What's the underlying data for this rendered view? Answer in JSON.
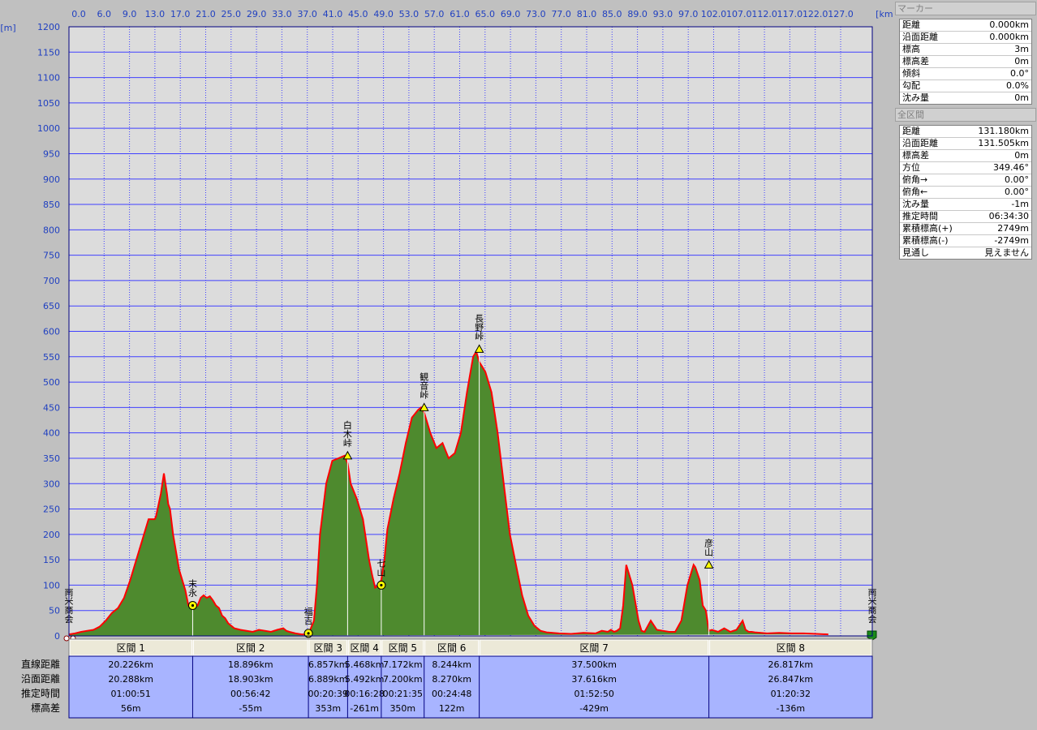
{
  "marker_panel": {
    "title": "マーカー",
    "rows": [
      {
        "label": "距離",
        "value": "0.000km"
      },
      {
        "label": "沿面距離",
        "value": "0.000km"
      },
      {
        "label": "標高",
        "value": "3m"
      },
      {
        "label": "標高差",
        "value": "0m"
      },
      {
        "label": "傾斜",
        "value": "0.0°"
      },
      {
        "label": "勾配",
        "value": "0.0%"
      },
      {
        "label": "沈み量",
        "value": "0m"
      }
    ]
  },
  "all_section_panel": {
    "title": "全区間",
    "rows": [
      {
        "label": "距離",
        "value": "131.180km"
      },
      {
        "label": "沿面距離",
        "value": "131.505km"
      },
      {
        "label": "標高差",
        "value": "0m"
      },
      {
        "label": "方位",
        "value": "349.46°"
      },
      {
        "label": "俯角→",
        "value": "0.00°"
      },
      {
        "label": "俯角←",
        "value": "0.00°"
      },
      {
        "label": "沈み量",
        "value": "-1m"
      },
      {
        "label": "推定時間",
        "value": "06:34:30"
      },
      {
        "label": "累積標高(+)",
        "value": "2749m"
      },
      {
        "label": "累積標高(-)",
        "value": "-2749m"
      },
      {
        "label": "見通し",
        "value": "見えません"
      }
    ]
  },
  "colors": {
    "fill": "#4e8a2e",
    "line": "#ff0000",
    "plot_bg": "#dcdcdc",
    "grid": "#4040ff",
    "table_bg": "#a8b4ff"
  },
  "chart_data": {
    "type": "area",
    "x_unit": "[km]",
    "y_unit": "[m]",
    "xlim": [
      0,
      131.18
    ],
    "ylim": [
      0,
      1200
    ],
    "x_tick_labels": [
      "0.0",
      "6.0",
      "9.0",
      "13.0",
      "17.0",
      "21.0",
      "25.0",
      "29.0",
      "33.0",
      "37.0",
      "41.0",
      "45.0",
      "49.0",
      "53.0",
      "57.0",
      "61.0",
      "65.0",
      "69.0",
      "73.0",
      "77.0",
      "81.0",
      "85.0",
      "89.0",
      "93.0",
      "97.0",
      "102.0",
      "107.0",
      "112.0",
      "117.0",
      "122.0",
      "127.0"
    ],
    "y_ticks": [
      0,
      50,
      100,
      150,
      200,
      250,
      300,
      350,
      400,
      450,
      500,
      550,
      600,
      650,
      700,
      750,
      800,
      850,
      900,
      950,
      1000,
      1050,
      1100,
      1150,
      1200
    ],
    "grid": true,
    "x": [
      0,
      1,
      2,
      3,
      4,
      5,
      6,
      7,
      8,
      9,
      10,
      11,
      12,
      13,
      14,
      14.2,
      15,
      15.5,
      16,
      16.2,
      16.5,
      17,
      18,
      19,
      19.5,
      20.2,
      21,
      21.5,
      22,
      22.5,
      23,
      23.5,
      24,
      24.5,
      25,
      25.5,
      26,
      27,
      28,
      29,
      30,
      31,
      32,
      33,
      34,
      35,
      35.5,
      36,
      37,
      38,
      39,
      39.1,
      40,
      40.5,
      41,
      42,
      43,
      44,
      45,
      45.5,
      46,
      47,
      48,
      49,
      49.5,
      50,
      50.5,
      51,
      51.5,
      52,
      53,
      54,
      55,
      56,
      57,
      57.5,
      58,
      59,
      60,
      61,
      62,
      63,
      64,
      65,
      66,
      66.5,
      67,
      67.5,
      68,
      69,
      70,
      71,
      72,
      73,
      74,
      75,
      76,
      77,
      78,
      80,
      82,
      84,
      86,
      87,
      88,
      88.5,
      89,
      89.5,
      90,
      90.5,
      91,
      92,
      93,
      93.5,
      94,
      95,
      96,
      97,
      98,
      99,
      100,
      101,
      102,
      102.3,
      103,
      103.5,
      104,
      104.5,
      105,
      106,
      107,
      108,
      109,
      110,
      110.5,
      111,
      111.5,
      112,
      113,
      114,
      116,
      118,
      120,
      122,
      124,
      126,
      128,
      130,
      131.18
    ],
    "y": [
      3,
      5,
      8,
      10,
      12,
      18,
      30,
      45,
      55,
      75,
      110,
      150,
      190,
      230,
      230,
      235,
      280,
      320,
      280,
      260,
      250,
      200,
      130,
      90,
      60,
      55,
      60,
      75,
      80,
      75,
      78,
      70,
      60,
      55,
      40,
      35,
      25,
      15,
      12,
      10,
      8,
      12,
      10,
      8,
      12,
      15,
      10,
      8,
      5,
      3,
      3,
      3,
      30,
      100,
      200,
      300,
      345,
      350,
      355,
      340,
      300,
      270,
      230,
      150,
      120,
      95,
      100,
      110,
      150,
      210,
      270,
      320,
      380,
      430,
      445,
      450,
      440,
      400,
      370,
      380,
      350,
      360,
      400,
      480,
      550,
      560,
      540,
      530,
      520,
      480,
      400,
      300,
      200,
      140,
      80,
      40,
      20,
      10,
      7,
      5,
      4,
      6,
      5,
      10,
      8,
      12,
      8,
      10,
      15,
      60,
      140,
      100,
      30,
      10,
      8,
      30,
      12,
      10,
      8,
      8,
      30,
      100,
      140,
      135,
      110,
      60,
      50,
      10,
      12,
      8,
      15,
      8,
      12,
      30,
      12,
      8,
      8,
      7,
      6,
      5,
      6,
      5,
      5,
      4,
      3
    ]
  },
  "waypoints": [
    {
      "name": "南米商会",
      "x": 0,
      "y": 3,
      "type": "start"
    },
    {
      "name": "末永",
      "x": 20.2,
      "y": 60,
      "type": "circle"
    },
    {
      "name": "福吉",
      "x": 39.1,
      "y": 5,
      "type": "circle"
    },
    {
      "name": "白木峠",
      "x": 45.5,
      "y": 355,
      "type": "triangle"
    },
    {
      "name": "七山",
      "x": 51,
      "y": 100,
      "type": "circle"
    },
    {
      "name": "観音峠",
      "x": 58,
      "y": 450,
      "type": "triangle"
    },
    {
      "name": "長野峠",
      "x": 67,
      "y": 565,
      "type": "triangle"
    },
    {
      "name": "彦山",
      "x": 104.5,
      "y": 140,
      "type": "triangle"
    },
    {
      "name": "南米商会",
      "x": 131.18,
      "y": 3,
      "type": "goal"
    }
  ],
  "section_boundaries_km": [
    0,
    20.2,
    39.1,
    45.5,
    51,
    58,
    67,
    104.5,
    131.18
  ],
  "section_table": {
    "row_labels": [
      "直線距離",
      "沿面距離",
      "推定時間",
      "標高差"
    ],
    "sections": [
      {
        "name": "区間 1",
        "straight": "20.226km",
        "surface": "20.288km",
        "time": "01:00:51",
        "diff": "56m"
      },
      {
        "name": "区間 2",
        "straight": "18.896km",
        "surface": "18.903km",
        "time": "00:56:42",
        "diff": "-55m"
      },
      {
        "name": "区間 3",
        "straight": "6.857km",
        "surface": "6.889km",
        "time": "00:20:39",
        "diff": "353m"
      },
      {
        "name": "区間 4",
        "straight": "5.468km",
        "surface": "5.492km",
        "time": "00:16:28",
        "diff": "-261m"
      },
      {
        "name": "区間 5",
        "straight": "7.172km",
        "surface": "7.200km",
        "time": "00:21:35",
        "diff": "350m"
      },
      {
        "name": "区間 6",
        "straight": "8.244km",
        "surface": "8.270km",
        "time": "00:24:48",
        "diff": "122m"
      },
      {
        "name": "区間 7",
        "straight": "37.500km",
        "surface": "37.616km",
        "time": "01:52:50",
        "diff": "-429m"
      },
      {
        "name": "区間 8",
        "straight": "26.817km",
        "surface": "26.847km",
        "time": "01:20:32",
        "diff": "-136m"
      }
    ]
  }
}
